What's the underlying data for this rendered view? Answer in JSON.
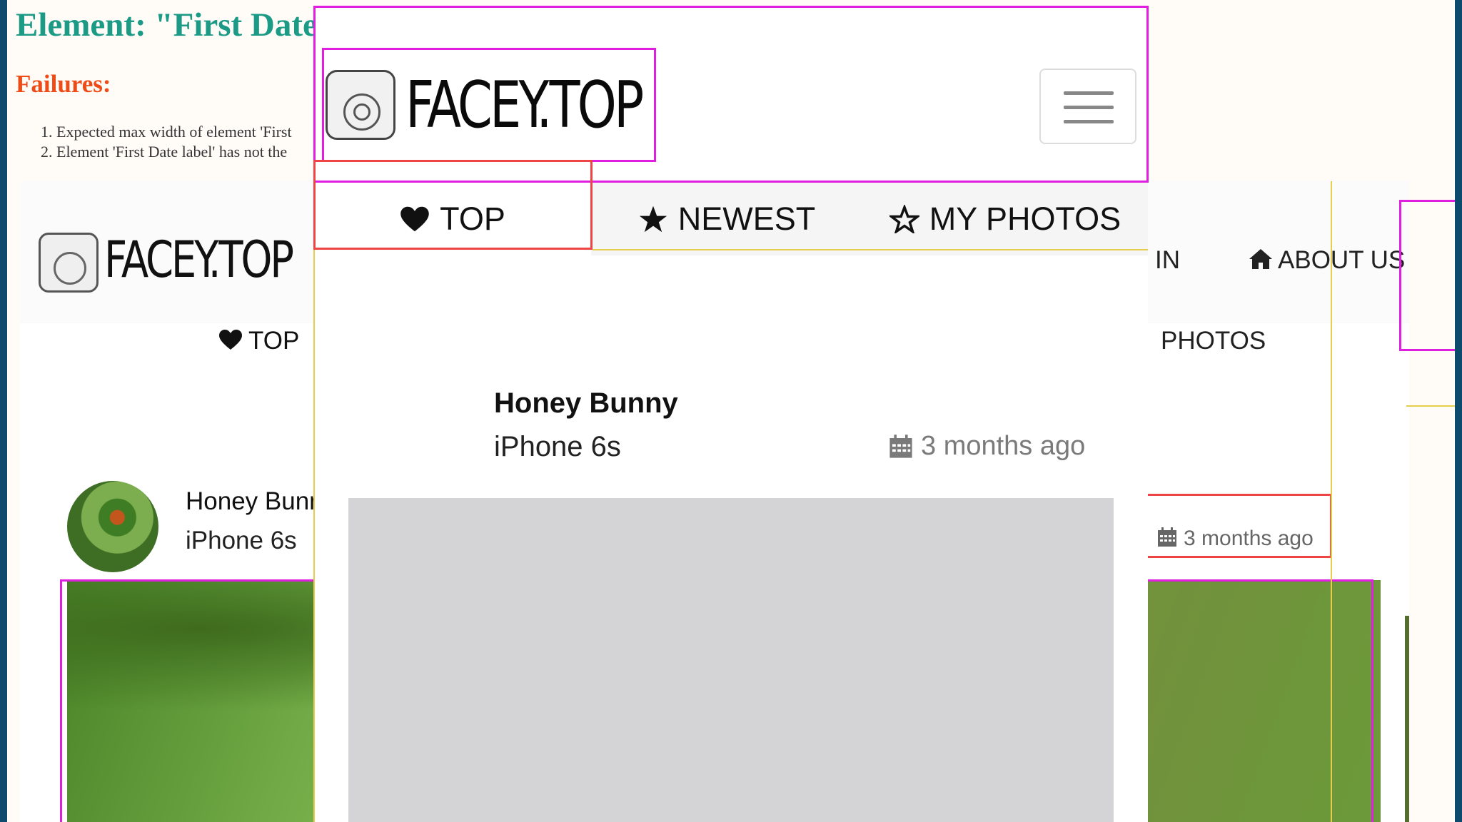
{
  "report": {
    "title": "Element: \"First Date",
    "failures_label": "Failures:",
    "failures": [
      "1. Expected max width of element 'First",
      "2. Element 'First Date label' has not the"
    ]
  },
  "background_page": {
    "logo_text": "FACEY.TOP",
    "nav_top": "TOP",
    "nav_sign_in": "IN",
    "nav_about": "ABOUT US",
    "nav_us": "US",
    "nav_photos": "PHOTOS",
    "post": {
      "user": "Honey Bunn",
      "device": "iPhone 6s",
      "date": "3 months ago"
    }
  },
  "mobile_page": {
    "logo_text": "FACEY.TOP",
    "menu_icon": "hamburger-icon",
    "tabs": [
      {
        "label": "TOP",
        "icon": "heart-icon"
      },
      {
        "label": "NEWEST",
        "icon": "star-filled-icon"
      },
      {
        "label": "MY PHOTOS",
        "icon": "star-outline-icon"
      }
    ],
    "post": {
      "user": "Honey Bunny",
      "device": "iPhone 6s",
      "date": "3 months ago",
      "date_icon": "calendar-icon"
    }
  },
  "colors": {
    "report_title": "#1b9a86",
    "failure_label": "#ee4b17",
    "highlight_magenta": "#e01ee0",
    "highlight_red": "#ee4444",
    "highlight_yellow": "#e6cd4a",
    "frame_border": "#0c4a6e",
    "photo_placeholder": "#d4d3d6"
  }
}
